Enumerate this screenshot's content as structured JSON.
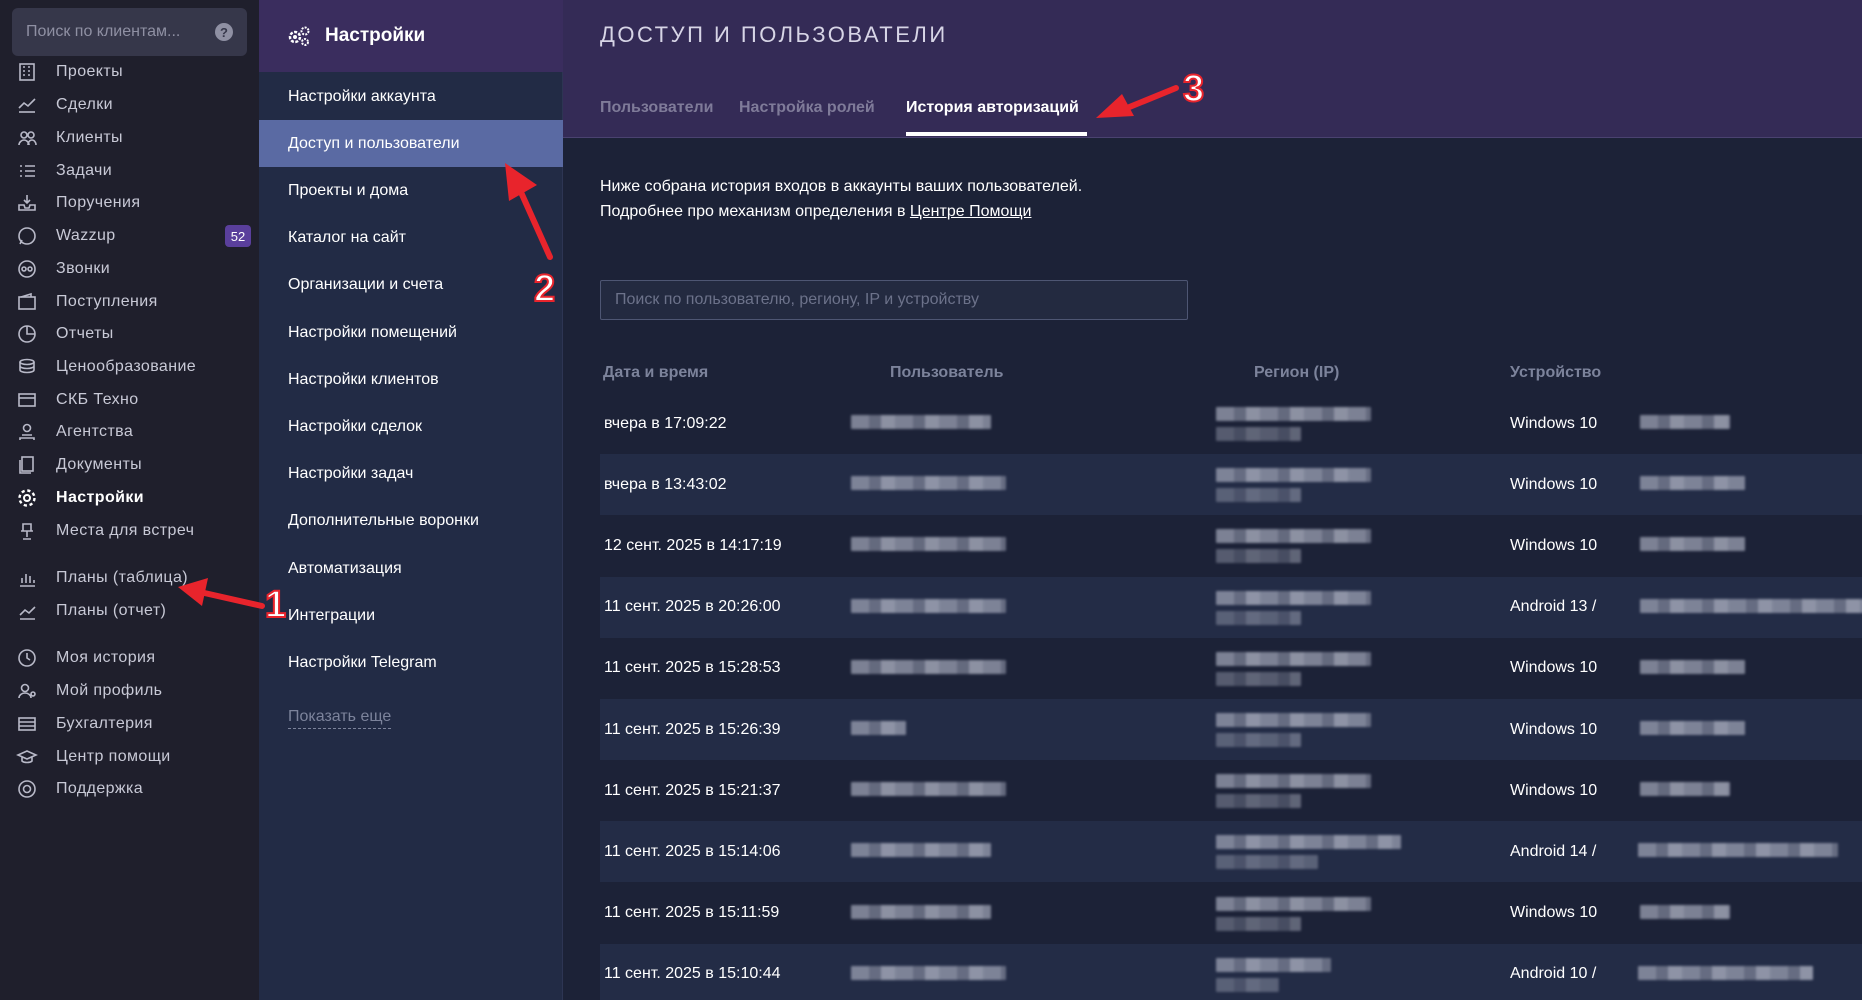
{
  "search": {
    "placeholder": "Поиск по клиентам...",
    "help": "?"
  },
  "nav": {
    "items": [
      {
        "label": "Проекты",
        "icon": "building-icon"
      },
      {
        "label": "Сделки",
        "icon": "deal-icon"
      },
      {
        "label": "Клиенты",
        "icon": "users-icon"
      },
      {
        "label": "Задачи",
        "icon": "tasks-icon"
      },
      {
        "label": "Поручения",
        "icon": "inbox-icon"
      },
      {
        "label": "Wazzup",
        "icon": "whatsapp-icon",
        "badge": "52"
      },
      {
        "label": "Звонки",
        "icon": "phone-icon"
      },
      {
        "label": "Поступления",
        "icon": "wallet-icon"
      },
      {
        "label": "Отчеты",
        "icon": "pie-chart-icon"
      },
      {
        "label": "Ценообразование",
        "icon": "coins-icon"
      },
      {
        "label": "СКБ Техно",
        "icon": "card-icon"
      },
      {
        "label": "Агентства",
        "icon": "agent-icon"
      },
      {
        "label": "Документы",
        "icon": "documents-icon"
      },
      {
        "label": "Настройки",
        "icon": "gear-icon",
        "active": true
      },
      {
        "label": "Места для встреч",
        "icon": "meeting-icon"
      },
      {
        "label": "Планы (таблица)",
        "icon": "bar-chart-icon"
      },
      {
        "label": "Планы (отчет)",
        "icon": "line-chart-icon"
      },
      {
        "label": "Моя история",
        "icon": "history-icon"
      },
      {
        "label": "Мой профиль",
        "icon": "profile-icon"
      },
      {
        "label": "Бухгалтерия",
        "icon": "accounting-icon"
      },
      {
        "label": "Центр помощи",
        "icon": "graduation-icon"
      },
      {
        "label": "Поддержка",
        "icon": "lifebuoy-icon"
      }
    ]
  },
  "settings": {
    "title": "Настройки",
    "items": [
      "Настройки аккаунта",
      "Доступ и пользователи",
      "Проекты и дома",
      "Каталог на сайт",
      "Организации и счета",
      "Настройки помещений",
      "Настройки клиентов",
      "Настройки сделок",
      "Настройки задач",
      "Дополнительные воронки",
      "Автоматизация",
      "Интеграции",
      "Настройки Telegram"
    ],
    "active_index": 1,
    "show_more": "Показать еще"
  },
  "main": {
    "title": "ДОСТУП И ПОЛЬЗОВАТЕЛИ",
    "tabs": [
      "Пользователи",
      "Настройка ролей",
      "История авторизаций"
    ],
    "active_tab": 2,
    "desc_line1": "Ниже собрана история входов в аккаунты ваших пользователей.",
    "desc_line2_prefix": "Подробнее про механизм определения в ",
    "desc_link": "Центре Помощи",
    "filter_placeholder": "Поиск по пользователю, региону, IP и устройству",
    "columns": [
      "Дата и время",
      "Пользователь",
      "Регион (IP)",
      "Устройство"
    ],
    "rows": [
      {
        "datetime": "вчера в 17:09:22",
        "device": "Windows 10"
      },
      {
        "datetime": "вчера в 13:43:02",
        "device": "Windows 10"
      },
      {
        "datetime": "12 сент. 2025 в 14:17:19",
        "device": "Windows 10"
      },
      {
        "datetime": "11 сент. 2025 в 20:26:00",
        "device": "Android 13 /"
      },
      {
        "datetime": "11 сент. 2025 в 15:28:53",
        "device": "Windows 10"
      },
      {
        "datetime": "11 сент. 2025 в 15:26:39",
        "device": "Windows 10"
      },
      {
        "datetime": "11 сент. 2025 в 15:21:37",
        "device": "Windows 10"
      },
      {
        "datetime": "11 сент. 2025 в 15:14:06",
        "device": "Android 14 /"
      },
      {
        "datetime": "11 сент. 2025 в 15:11:59",
        "device": "Windows 10"
      },
      {
        "datetime": "11 сент. 2025 в 15:10:44",
        "device": "Android 10 /"
      }
    ]
  },
  "annotations": [
    "1",
    "2",
    "3"
  ],
  "colors": {
    "accent": "#5a6aa3",
    "header": "#342b56",
    "badge": "#5a3f9c",
    "arrow": "#e8242c"
  }
}
